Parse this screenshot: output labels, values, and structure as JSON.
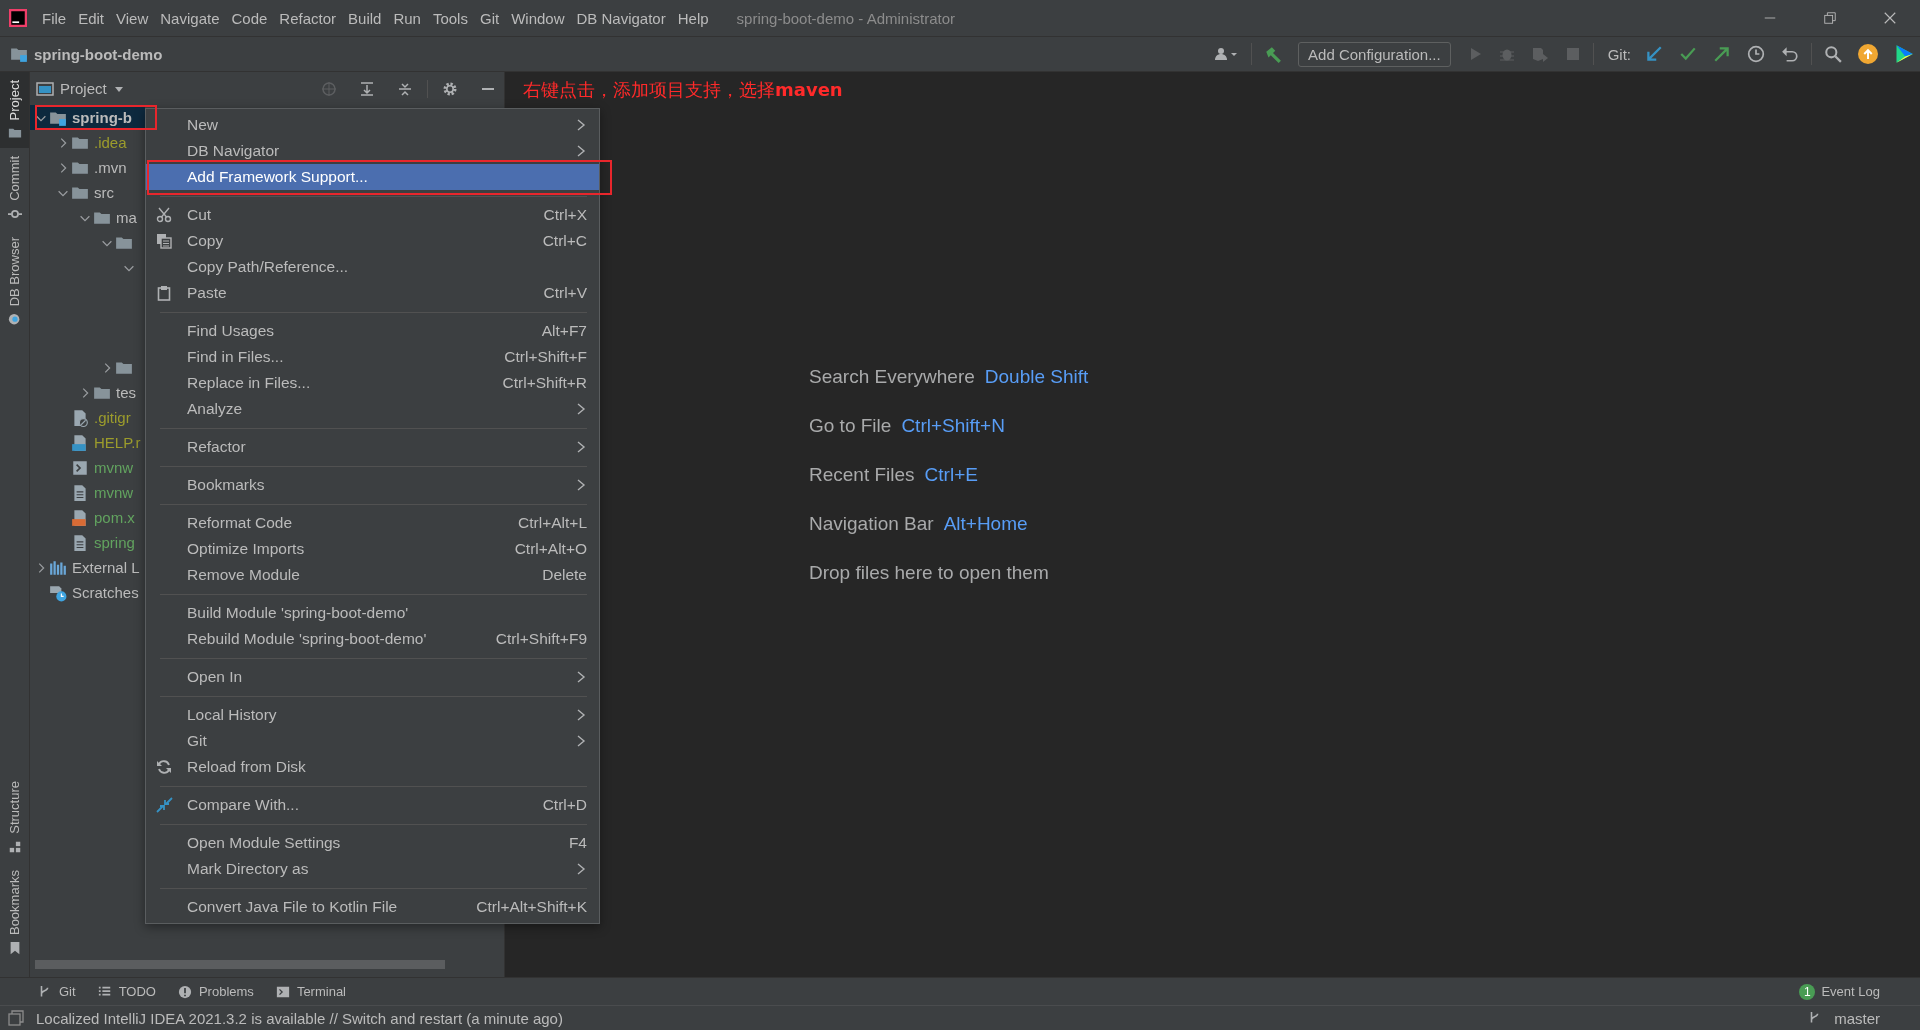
{
  "title_bar": {
    "menus": [
      "File",
      "Edit",
      "View",
      "Navigate",
      "Code",
      "Refactor",
      "Build",
      "Run",
      "Tools",
      "Git",
      "Window",
      "DB Navigator",
      "Help"
    ],
    "title": "spring-boot-demo - Administrator"
  },
  "nav_bar": {
    "project": "spring-boot-demo",
    "run_config": "Add Configuration...",
    "git_label": "Git:"
  },
  "left_strip": {
    "top": [
      {
        "label": "Project",
        "selected": true
      },
      {
        "label": "Commit",
        "selected": false
      },
      {
        "label": "DB Browser",
        "selected": false
      }
    ],
    "bottom": [
      {
        "label": "Structure",
        "selected": false
      },
      {
        "label": "Bookmarks",
        "selected": false
      }
    ]
  },
  "project_panel": {
    "title": "Project",
    "tree": [
      {
        "label": "spring-b",
        "kind": "module",
        "expanded": true,
        "selected": true,
        "outlined": true,
        "children": [
          {
            "label": ".idea",
            "kind": "folder",
            "expanded": false,
            "selected": false,
            "color": "#9c9c2c"
          },
          {
            "label": ".mvn",
            "kind": "folder",
            "expanded": false,
            "selected": false
          },
          {
            "label": "src",
            "kind": "folder",
            "expanded": true,
            "selected": false,
            "children": [
              {
                "label": "ma",
                "kind": "folder",
                "expanded": true,
                "selected": false,
                "children": [
                  {
                    "kind": "folder",
                    "expanded": true,
                    "selected": false,
                    "children": [
                      {
                        "expanded": true,
                        "selected": false
                      }
                    ]
                  },
                  {
                    "kind": "folder",
                    "expanded": false,
                    "selected": false
                  }
                ]
              },
              {
                "label": "tes",
                "kind": "folder",
                "expanded": false,
                "selected": false
              }
            ]
          },
          {
            "label": ".gitigr",
            "kind": "ignore-file",
            "selected": false,
            "color": "#9c9c2c"
          },
          {
            "label": "HELP.r",
            "kind": "markdown-file",
            "selected": false,
            "color": "#9c9c2c"
          },
          {
            "label": "mvnw",
            "kind": "shell-file",
            "selected": false,
            "color": "#62a35f"
          },
          {
            "label": "mvnw",
            "kind": "text-file",
            "selected": false,
            "color": "#62a35f"
          },
          {
            "label": "pom.x",
            "kind": "xml-file",
            "selected": false,
            "color": "#62a35f"
          },
          {
            "label": "spring",
            "kind": "text-file",
            "selected": false,
            "color": "#62a35f"
          }
        ]
      },
      {
        "label": "External L",
        "kind": "library",
        "expanded": false,
        "selected": false
      },
      {
        "label": "Scratches",
        "kind": "scratches",
        "selected": false
      }
    ]
  },
  "context_menu": {
    "items": [
      {
        "kind": "item",
        "label": "New",
        "submenu": true,
        "selected": false,
        "outlined": false
      },
      {
        "kind": "item",
        "label": "DB Navigator",
        "submenu": true,
        "selected": false,
        "outlined": false
      },
      {
        "kind": "item",
        "label": "Add Framework Support...",
        "selected": true,
        "outlined": true
      },
      {
        "kind": "separator"
      },
      {
        "kind": "item",
        "label": "Cut",
        "shortcut": "Ctrl+X",
        "selected": false,
        "outlined": false
      },
      {
        "kind": "item",
        "label": "Copy",
        "shortcut": "Ctrl+C",
        "selected": false,
        "outlined": false
      },
      {
        "kind": "item",
        "label": "Copy Path/Reference...",
        "selected": false,
        "outlined": false
      },
      {
        "kind": "item",
        "label": "Paste",
        "shortcut": "Ctrl+V",
        "selected": false,
        "outlined": false
      },
      {
        "kind": "separator"
      },
      {
        "kind": "item",
        "label": "Find Usages",
        "shortcut": "Alt+F7",
        "selected": false,
        "outlined": false
      },
      {
        "kind": "item",
        "label": "Find in Files...",
        "shortcut": "Ctrl+Shift+F",
        "selected": false,
        "outlined": false
      },
      {
        "kind": "item",
        "label": "Replace in Files...",
        "shortcut": "Ctrl+Shift+R",
        "selected": false,
        "outlined": false
      },
      {
        "kind": "item",
        "label": "Analyze",
        "submenu": true,
        "selected": false,
        "outlined": false
      },
      {
        "kind": "separator"
      },
      {
        "kind": "item",
        "label": "Refactor",
        "submenu": true,
        "selected": false,
        "outlined": false
      },
      {
        "kind": "separator"
      },
      {
        "kind": "item",
        "label": "Bookmarks",
        "submenu": true,
        "selected": false,
        "outlined": false
      },
      {
        "kind": "separator"
      },
      {
        "kind": "item",
        "label": "Reformat Code",
        "shortcut": "Ctrl+Alt+L",
        "selected": false,
        "outlined": false
      },
      {
        "kind": "item",
        "label": "Optimize Imports",
        "shortcut": "Ctrl+Alt+O",
        "selected": false,
        "outlined": false
      },
      {
        "kind": "item",
        "label": "Remove Module",
        "shortcut": "Delete",
        "selected": false,
        "outlined": false
      },
      {
        "kind": "separator"
      },
      {
        "kind": "item",
        "label": "Build Module 'spring-boot-demo'",
        "selected": false,
        "outlined": false
      },
      {
        "kind": "item",
        "label": "Rebuild Module 'spring-boot-demo'",
        "shortcut": "Ctrl+Shift+F9",
        "selected": false,
        "outlined": false
      },
      {
        "kind": "separator"
      },
      {
        "kind": "item",
        "label": "Open In",
        "submenu": true,
        "selected": false,
        "outlined": false
      },
      {
        "kind": "separator"
      },
      {
        "kind": "item",
        "label": "Local History",
        "submenu": true,
        "selected": false,
        "outlined": false
      },
      {
        "kind": "item",
        "label": "Git",
        "submenu": true,
        "selected": false,
        "outlined": false
      },
      {
        "kind": "item",
        "label": "Reload from Disk",
        "selected": false,
        "outlined": false
      },
      {
        "kind": "separator"
      },
      {
        "kind": "item",
        "label": "Compare With...",
        "shortcut": "Ctrl+D",
        "selected": false,
        "outlined": false
      },
      {
        "kind": "separator"
      },
      {
        "kind": "item",
        "label": "Open Module Settings",
        "shortcut": "F4",
        "selected": false,
        "outlined": false
      },
      {
        "kind": "item",
        "label": "Mark Directory as",
        "submenu": true,
        "selected": false,
        "outlined": false
      },
      {
        "kind": "separator"
      },
      {
        "kind": "item",
        "label": "Convert Java File to Kotlin File",
        "shortcut": "Ctrl+Alt+Shift+K",
        "selected": false,
        "outlined": false
      }
    ]
  },
  "editor": {
    "annotation": "右键点击，添加项目支持，选择**maven**",
    "hints": [
      {
        "label": "Search Everywhere",
        "shortcut": "Double Shift"
      },
      {
        "label": "Go to File",
        "shortcut": "Ctrl+Shift+N"
      },
      {
        "label": "Recent Files",
        "shortcut": "Ctrl+E"
      },
      {
        "label": "Navigation Bar",
        "shortcut": "Alt+Home"
      },
      {
        "label": "Drop files here to open them"
      }
    ]
  },
  "tool_tabs": [
    "Git",
    "TODO",
    "Problems",
    "Terminal"
  ],
  "event_log": {
    "label": "Event Log",
    "count": "1"
  },
  "status_bar": {
    "message": "Localized IntelliJ IDEA 2021.3.2 is available // Switch and restart (a minute ago)",
    "branch": "master"
  }
}
